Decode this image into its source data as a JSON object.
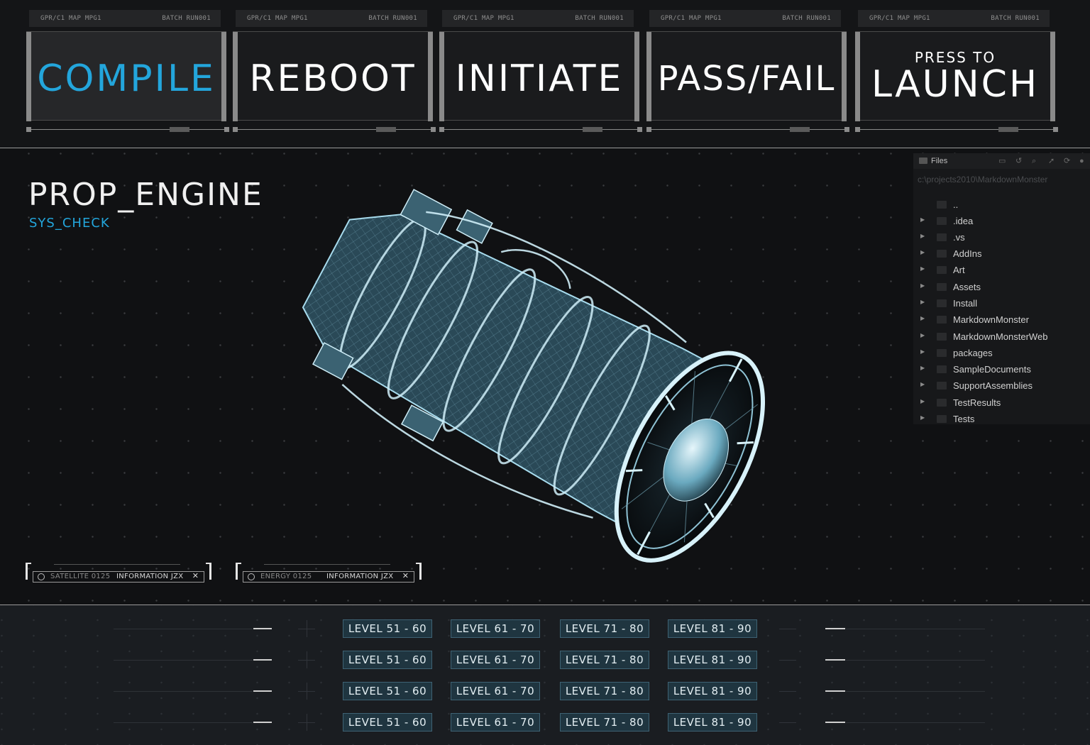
{
  "commands": [
    {
      "meta_left": "GPR/C1 MAP MPG1",
      "meta_right": "BATCH RUN001",
      "label": "COMPILE"
    },
    {
      "meta_left": "GPR/C1 MAP MPG1",
      "meta_right": "BATCH RUN001",
      "label": "REBOOT"
    },
    {
      "meta_left": "GPR/C1 MAP MPG1",
      "meta_right": "BATCH RUN001",
      "label": "INITIATE"
    },
    {
      "meta_left": "GPR/C1 MAP MPG1",
      "meta_right": "BATCH RUN001",
      "label": "PASS/FAIL"
    },
    {
      "meta_left": "GPR/C1 MAP MPG1",
      "meta_right": "BATCH RUN001",
      "label_small": "PRESS TO",
      "label": "LAUNCH"
    }
  ],
  "viewport": {
    "title": "PROP_ENGINE",
    "subtitle": "SYS_CHECK"
  },
  "files_panel": {
    "title": "Files",
    "path": "c:\\projects2010\\MarkdownMonster",
    "items": [
      {
        "name": ".."
      },
      {
        "name": ".idea"
      },
      {
        "name": ".vs"
      },
      {
        "name": "AddIns"
      },
      {
        "name": "Art"
      },
      {
        "name": "Assets"
      },
      {
        "name": "Install"
      },
      {
        "name": "MarkdownMonster"
      },
      {
        "name": "MarkdownMonsterWeb"
      },
      {
        "name": "packages"
      },
      {
        "name": "SampleDocuments"
      },
      {
        "name": "SupportAssemblies"
      },
      {
        "name": "TestResults"
      },
      {
        "name": "Tests"
      }
    ]
  },
  "info_chips": [
    {
      "key": "SATELLITE 0125",
      "value": "INFORMATION JZX"
    },
    {
      "key": "ENERGY 0125",
      "value": "INFORMATION JZX"
    }
  ],
  "levels": [
    [
      "LEVEL 51 - 60",
      "LEVEL 61 - 70",
      "LEVEL 71 - 80",
      "LEVEL 81 - 90"
    ],
    [
      "LEVEL 51 - 60",
      "LEVEL 61 - 70",
      "LEVEL 71 - 80",
      "LEVEL 81 - 90"
    ],
    [
      "LEVEL 51 - 60",
      "LEVEL 61 - 70",
      "LEVEL 71 - 80",
      "LEVEL 81 - 90"
    ],
    [
      "LEVEL 51 - 60",
      "LEVEL 61 - 70",
      "LEVEL 71 - 80",
      "LEVEL 81 - 90"
    ]
  ],
  "colors": {
    "accent": "#23a6dc",
    "background": "#141517",
    "level_button": "#1f3540"
  }
}
